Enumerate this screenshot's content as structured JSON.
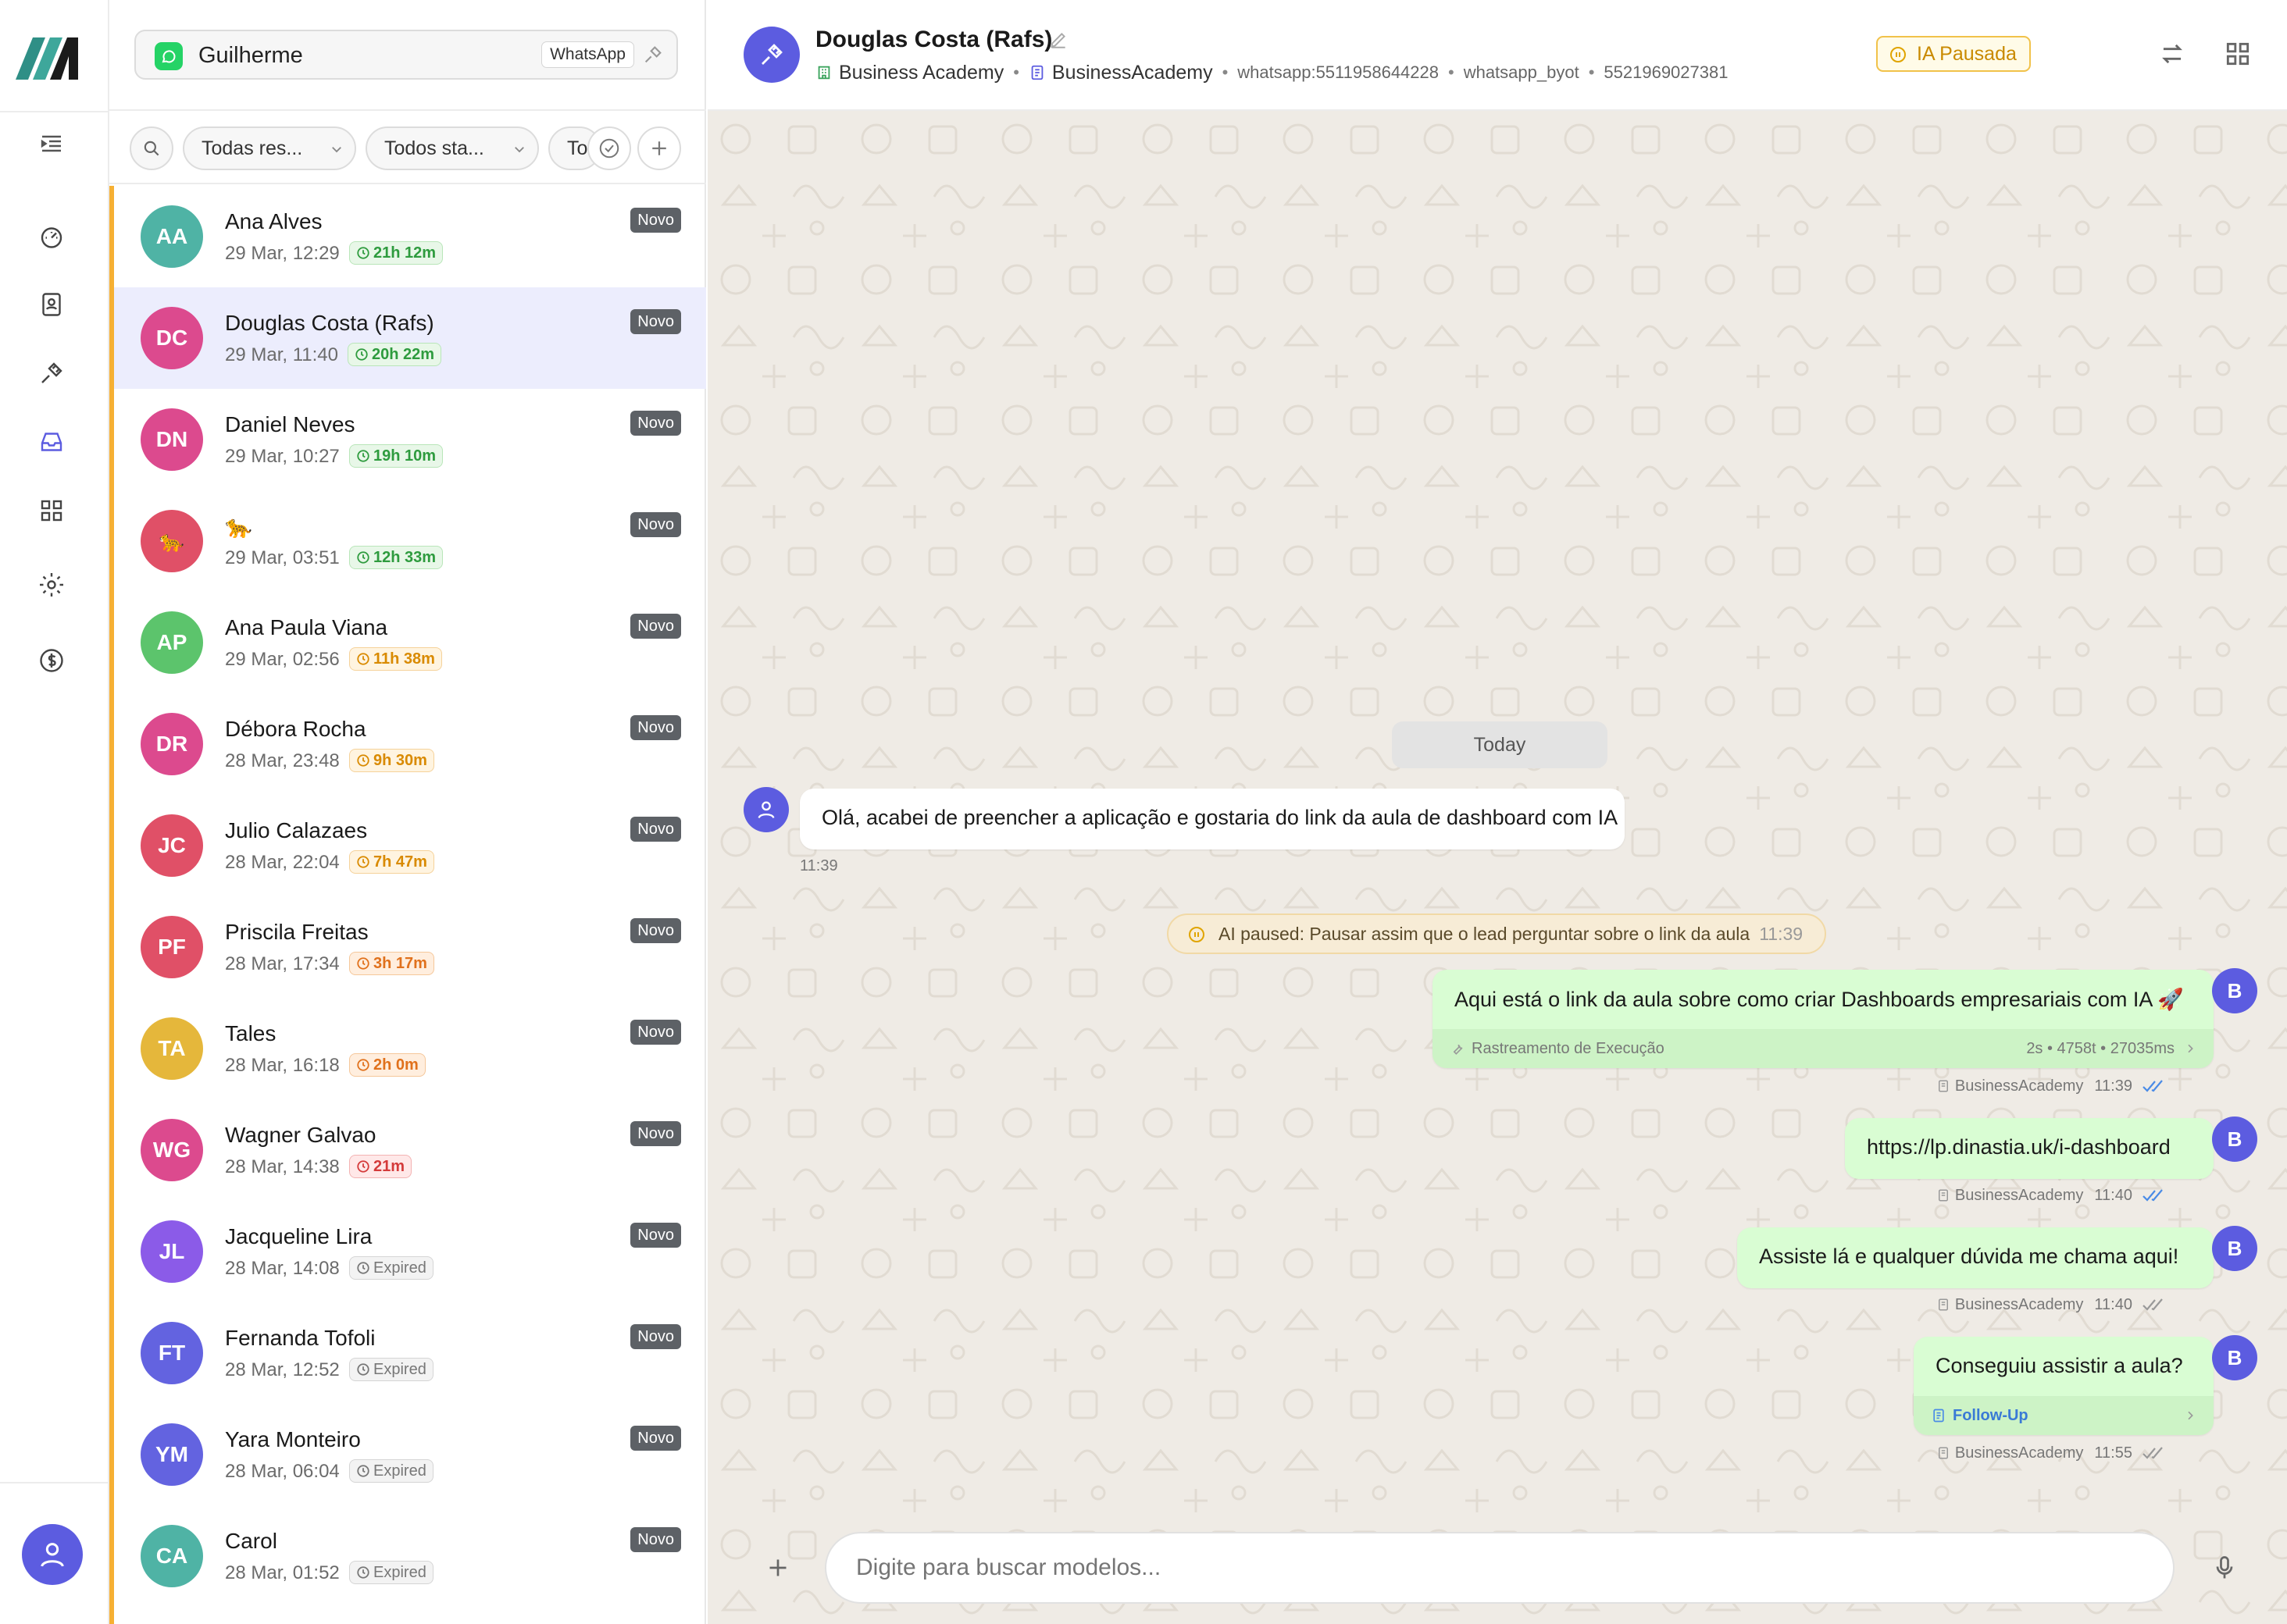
{
  "inbox": {
    "name": "Guilherme",
    "channel": "WhatsApp"
  },
  "filters": {
    "responsible": "Todas res...",
    "status": "Todos sta...",
    "third": "To"
  },
  "conversations": [
    {
      "initials": "AA",
      "name": "Ana Alves",
      "date": "29 Mar, 12:29",
      "timer": "21h 12m",
      "badge": "Novo",
      "color": "#4fb3a5",
      "timer_kind": "green"
    },
    {
      "initials": "DC",
      "name": "Douglas Costa (Rafs)",
      "date": "29 Mar, 11:40",
      "timer": "20h 22m",
      "badge": "Novo",
      "color": "#dc4a8e",
      "timer_kind": "green"
    },
    {
      "initials": "DN",
      "name": "Daniel Neves",
      "date": "29 Mar, 10:27",
      "timer": "19h 10m",
      "badge": "Novo",
      "color": "#dc4a8e",
      "timer_kind": "green"
    },
    {
      "initials": "🐆",
      "name": "🐆",
      "date": "29 Mar, 03:51",
      "timer": "12h 33m",
      "badge": "Novo",
      "color": "#e05067",
      "timer_kind": "green"
    },
    {
      "initials": "AP",
      "name": "Ana Paula Viana",
      "date": "29 Mar, 02:56",
      "timer": "11h 38m",
      "badge": "Novo",
      "color": "#5cc46c",
      "timer_kind": "orange"
    },
    {
      "initials": "DR",
      "name": "Débora Rocha",
      "date": "28 Mar, 23:48",
      "timer": "9h 30m",
      "badge": "Novo",
      "color": "#dc4a8e",
      "timer_kind": "orange"
    },
    {
      "initials": "JC",
      "name": "Julio Calazaes",
      "date": "28 Mar, 22:04",
      "timer": "7h 47m",
      "badge": "Novo",
      "color": "#e05067",
      "timer_kind": "orange"
    },
    {
      "initials": "PF",
      "name": "Priscila Freitas",
      "date": "28 Mar, 17:34",
      "timer": "3h 17m",
      "badge": "Novo",
      "color": "#e05067",
      "timer_kind": "orange2"
    },
    {
      "initials": "TA",
      "name": "Tales",
      "date": "28 Mar, 16:18",
      "timer": "2h 0m",
      "badge": "Novo",
      "color": "#e5b73b",
      "timer_kind": "orange2"
    },
    {
      "initials": "WG",
      "name": "Wagner Galvao",
      "date": "28 Mar, 14:38",
      "timer": "21m",
      "badge": "Novo",
      "color": "#dc4a8e",
      "timer_kind": "red"
    },
    {
      "initials": "JL",
      "name": "Jacqueline Lira",
      "date": "28 Mar, 14:08",
      "timer": "Expired",
      "badge": "Novo",
      "color": "#8b5be8",
      "timer_kind": "gray"
    },
    {
      "initials": "FT",
      "name": "Fernanda Tofoli",
      "date": "28 Mar, 12:52",
      "timer": "Expired",
      "badge": "Novo",
      "color": "#6363e0",
      "timer_kind": "gray"
    },
    {
      "initials": "YM",
      "name": "Yara Monteiro",
      "date": "28 Mar, 06:04",
      "timer": "Expired",
      "badge": "Novo",
      "color": "#6363e0",
      "timer_kind": "gray"
    },
    {
      "initials": "CA",
      "name": "Carol",
      "date": "28 Mar, 01:52",
      "timer": "Expired",
      "badge": "Novo",
      "color": "#4fb3a5",
      "timer_kind": "gray"
    }
  ],
  "chat": {
    "name": "Douglas Costa (Rafs)",
    "org": "Business Academy",
    "agent": "BusinessAcademy",
    "whatsapp": "whatsapp:5511958644228",
    "provider": "whatsapp_byot",
    "phone": "5521969027381",
    "ai_status": "IA Pausada",
    "day": "Today",
    "incoming": {
      "text": "Olá, acabei de preencher a aplicação e gostaria do link da aula de dashboard com IA",
      "time": "11:39"
    },
    "system": {
      "text": "AI paused: Pausar assim que o lead perguntar sobre o link da aula",
      "time": "11:39"
    },
    "outgoing": [
      {
        "text": "Aqui está o link da aula sobre como criar Dashboards empresariais com IA 🚀",
        "sub_label": "Rastreamento de Execução",
        "sub_stats": "2s • 4758t • 27035ms",
        "sender": "BusinessAcademy",
        "time": "11:39",
        "avatar": "B"
      },
      {
        "text": "https://lp.dinastia.uk/i-dashboard",
        "sender": "BusinessAcademy",
        "time": "11:40",
        "avatar": "B"
      },
      {
        "text": "Assiste lá e qualquer dúvida me chama aqui!",
        "sender": "BusinessAcademy",
        "time": "11:40",
        "avatar": "B"
      },
      {
        "text": "Conseguiu assistir a aula?",
        "sub_label": "Follow-Up",
        "sender": "BusinessAcademy",
        "time": "11:55",
        "avatar": "B"
      }
    ],
    "composer_placeholder": "Digite para buscar modelos..."
  },
  "colors": {
    "accent": "#5c5ce0",
    "bubble_out": "#d9fdd3",
    "badge": "#5d6166",
    "warn": "#f6b033"
  }
}
